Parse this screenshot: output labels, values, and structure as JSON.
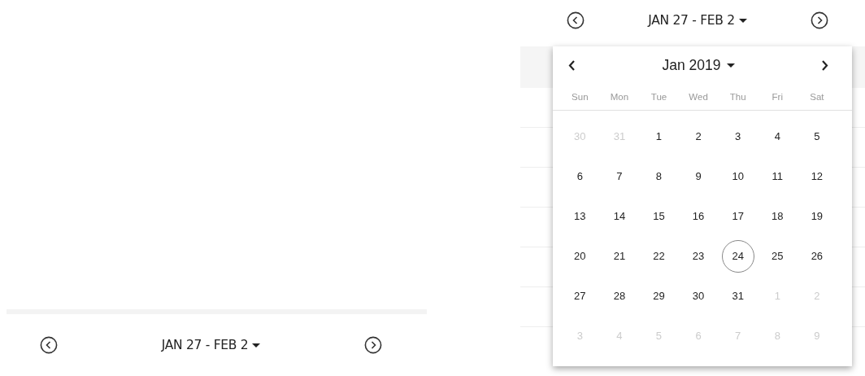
{
  "left_panel": {
    "week_nav": {
      "label": "JAN 27 - FEB 2"
    }
  },
  "right_panel": {
    "week_nav": {
      "label": "JAN 27 - FEB 2"
    },
    "calendar": {
      "month_label": "Jan 2019",
      "weekdays": [
        "Sun",
        "Mon",
        "Tue",
        "Wed",
        "Thu",
        "Fri",
        "Sat"
      ],
      "weeks": [
        [
          {
            "day": "30",
            "outside": true,
            "today": false
          },
          {
            "day": "31",
            "outside": true,
            "today": false
          },
          {
            "day": "1",
            "outside": false,
            "today": false
          },
          {
            "day": "2",
            "outside": false,
            "today": false
          },
          {
            "day": "3",
            "outside": false,
            "today": false
          },
          {
            "day": "4",
            "outside": false,
            "today": false
          },
          {
            "day": "5",
            "outside": false,
            "today": false
          }
        ],
        [
          {
            "day": "6",
            "outside": false,
            "today": false
          },
          {
            "day": "7",
            "outside": false,
            "today": false
          },
          {
            "day": "8",
            "outside": false,
            "today": false
          },
          {
            "day": "9",
            "outside": false,
            "today": false
          },
          {
            "day": "10",
            "outside": false,
            "today": false
          },
          {
            "day": "11",
            "outside": false,
            "today": false
          },
          {
            "day": "12",
            "outside": false,
            "today": false
          }
        ],
        [
          {
            "day": "13",
            "outside": false,
            "today": false
          },
          {
            "day": "14",
            "outside": false,
            "today": false
          },
          {
            "day": "15",
            "outside": false,
            "today": false
          },
          {
            "day": "16",
            "outside": false,
            "today": false
          },
          {
            "day": "17",
            "outside": false,
            "today": false
          },
          {
            "day": "18",
            "outside": false,
            "today": false
          },
          {
            "day": "19",
            "outside": false,
            "today": false
          }
        ],
        [
          {
            "day": "20",
            "outside": false,
            "today": false
          },
          {
            "day": "21",
            "outside": false,
            "today": false
          },
          {
            "day": "22",
            "outside": false,
            "today": false
          },
          {
            "day": "23",
            "outside": false,
            "today": false
          },
          {
            "day": "24",
            "outside": false,
            "today": true
          },
          {
            "day": "25",
            "outside": false,
            "today": false
          },
          {
            "day": "26",
            "outside": false,
            "today": false
          }
        ],
        [
          {
            "day": "27",
            "outside": false,
            "today": false
          },
          {
            "day": "28",
            "outside": false,
            "today": false
          },
          {
            "day": "29",
            "outside": false,
            "today": false
          },
          {
            "day": "30",
            "outside": false,
            "today": false
          },
          {
            "day": "31",
            "outside": false,
            "today": false
          },
          {
            "day": "1",
            "outside": true,
            "today": false
          },
          {
            "day": "2",
            "outside": true,
            "today": false
          }
        ],
        [
          {
            "day": "3",
            "outside": true,
            "today": false
          },
          {
            "day": "4",
            "outside": true,
            "today": false
          },
          {
            "day": "5",
            "outside": true,
            "today": false
          },
          {
            "day": "6",
            "outside": true,
            "today": false
          },
          {
            "day": "7",
            "outside": true,
            "today": false
          },
          {
            "day": "8",
            "outside": true,
            "today": false
          },
          {
            "day": "9",
            "outside": true,
            "today": false
          }
        ]
      ]
    }
  }
}
